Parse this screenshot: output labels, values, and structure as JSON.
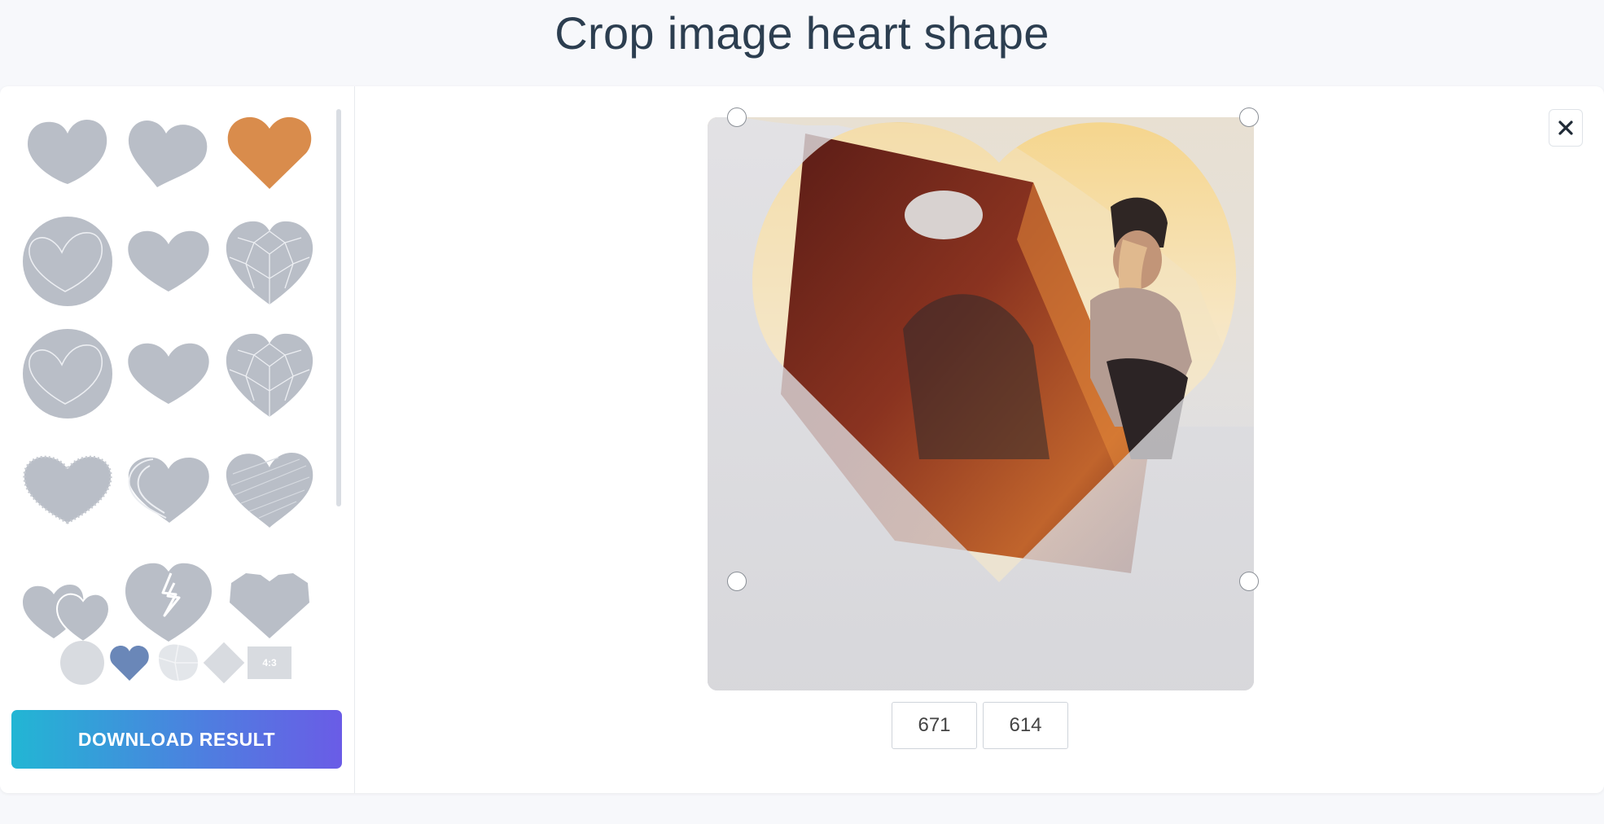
{
  "page": {
    "title": "Crop image heart shape"
  },
  "shapes": [
    {
      "name": "heart-classic",
      "selected": false
    },
    {
      "name": "heart-tilted",
      "selected": false
    },
    {
      "name": "heart-pointed",
      "selected": true
    },
    {
      "name": "heart-in-circle",
      "selected": false
    },
    {
      "name": "heart-rounded",
      "selected": false
    },
    {
      "name": "heart-faceted",
      "selected": false
    },
    {
      "name": "heart-in-circle-2",
      "selected": false
    },
    {
      "name": "heart-rounded-2",
      "selected": false
    },
    {
      "name": "heart-faceted-2",
      "selected": false
    },
    {
      "name": "heart-brush",
      "selected": false
    },
    {
      "name": "heart-swoosh",
      "selected": false
    },
    {
      "name": "heart-sketch",
      "selected": false
    },
    {
      "name": "double-heart",
      "selected": false
    },
    {
      "name": "broken-heart",
      "selected": false
    },
    {
      "name": "heart-flat-top",
      "selected": false
    }
  ],
  "small_shapes": [
    "circle",
    "heart",
    "blob",
    "diamond"
  ],
  "ratio_label": "4:3",
  "download_label": "DOWNLOAD RESULT",
  "dimensions": {
    "width": "671",
    "height": "614"
  },
  "colors": {
    "shape_default": "#b9bec7",
    "shape_selected": "#d98c4c",
    "small_heart": "#6a87b8",
    "button_gradient_start": "#22b6d4",
    "button_gradient_end": "#6a5ce6"
  },
  "icons": {
    "close": "close-icon"
  }
}
